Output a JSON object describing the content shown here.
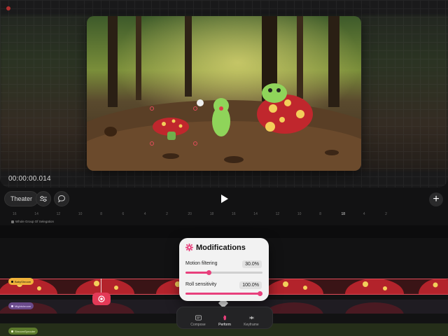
{
  "viewport": {
    "timecode": "00:00:00.014"
  },
  "toolbar": {
    "theater_label": "Theater",
    "add_label": "+"
  },
  "ruler": {
    "ticks": [
      "16",
      "14",
      "12",
      "10",
      "8",
      "6",
      "4",
      "2",
      "20",
      "18",
      "16",
      "14",
      "12",
      "10",
      "8",
      "6",
      "4",
      "2"
    ],
    "active_tick": "18"
  },
  "timeline": {
    "group_caption": "Whole Group Of Selegation",
    "tracks": [
      {
        "label": "BabyShroom",
        "color": "#f0b33a"
      },
      {
        "label": "Mightshroom",
        "color": "#6a4a8a"
      },
      {
        "label": "ShroomSprouter",
        "color": "#5d7a2c"
      }
    ]
  },
  "modifications": {
    "title": "Modifications",
    "params": [
      {
        "label": "Motion filtering",
        "value": "30.0%",
        "fraction": 0.3
      },
      {
        "label": "Roll sensitivity",
        "value": "100.0%",
        "fraction": 1.0
      }
    ],
    "accent_color": "#e8407c"
  },
  "tabbar": {
    "tabs": [
      {
        "label": "Compose",
        "icon": "compose-icon"
      },
      {
        "label": "Perform",
        "icon": "perform-icon",
        "active": true
      },
      {
        "label": "Keyframe",
        "icon": "keyframe-icon"
      }
    ]
  }
}
